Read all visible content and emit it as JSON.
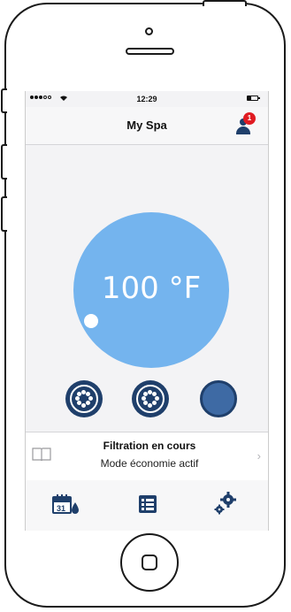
{
  "status_bar": {
    "time": "12:29",
    "wifi": "wifi-icon",
    "battery_level": 0.4
  },
  "nav": {
    "title": "My Spa",
    "notification_count": "1"
  },
  "temperature": {
    "value": "100 °F"
  },
  "info": {
    "title": "Filtration en cours",
    "subtitle": "Mode économie actif"
  },
  "tabs": [
    {
      "icon": "calendar-icon",
      "day": "31"
    },
    {
      "icon": "list-icon"
    },
    {
      "icon": "settings-icon"
    }
  ],
  "colors": {
    "accent_navy": "#1f3f6b",
    "dial_blue": "#74b4ee",
    "badge_red": "#e01b22"
  }
}
